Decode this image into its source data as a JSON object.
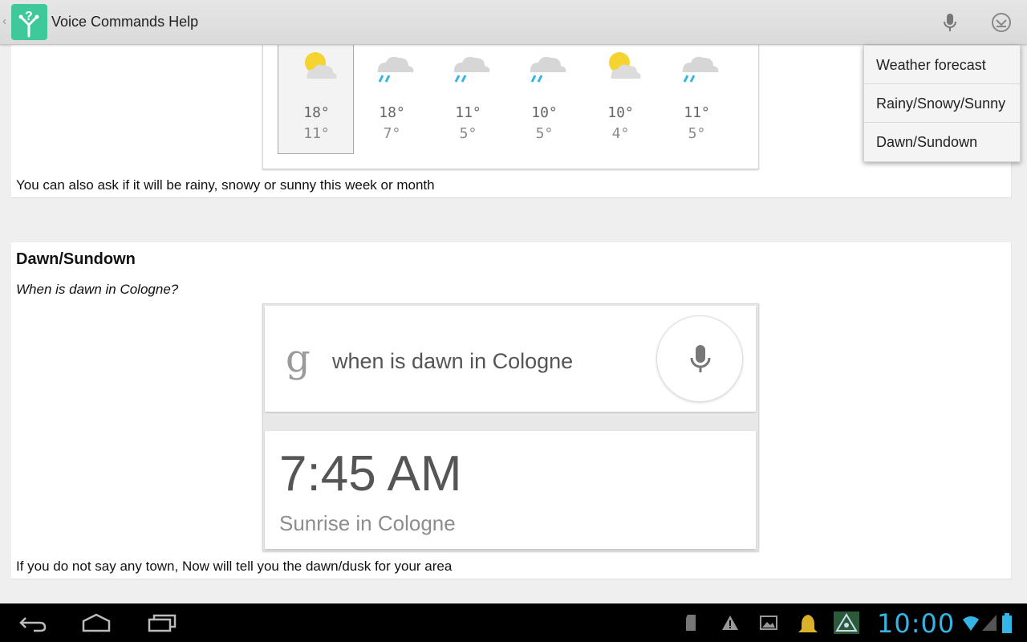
{
  "app": {
    "title": "Voice Commands Help",
    "accent": "#3fc99a"
  },
  "actionbar": {
    "icons": [
      "mic-icon",
      "overflow-menu-icon"
    ]
  },
  "menu": {
    "items": [
      "Weather forecast",
      "Rainy/Snowy/Sunny",
      "Dawn/Sundown"
    ]
  },
  "weather_section": {
    "forecast": [
      {
        "icon": "partly-sunny-icon",
        "high": "18°",
        "low": "11°",
        "selected": true
      },
      {
        "icon": "rain-cloud-icon",
        "high": "18°",
        "low": "7°"
      },
      {
        "icon": "rain-cloud-icon",
        "high": "11°",
        "low": "5°"
      },
      {
        "icon": "rain-cloud-icon",
        "high": "10°",
        "low": "5°"
      },
      {
        "icon": "partly-sunny-icon",
        "high": "10°",
        "low": "4°"
      },
      {
        "icon": "rain-cloud-icon",
        "high": "11°",
        "low": "5°"
      }
    ],
    "caption": "You can also ask if it will be rainy, snowy or sunny this week or month"
  },
  "dawn_section": {
    "title": "Dawn/Sundown",
    "query": "When is dawn in Cologne?",
    "search_text": "when is dawn in Cologne",
    "google_logo": "g",
    "result_time": "7:45 AM",
    "result_subtitle": "Sunrise in Cologne",
    "caption": "If you do not say any town, Now will tell you the dawn/dusk for your area"
  },
  "status": {
    "clock": "10:00",
    "clock_color": "#33b5e5"
  }
}
